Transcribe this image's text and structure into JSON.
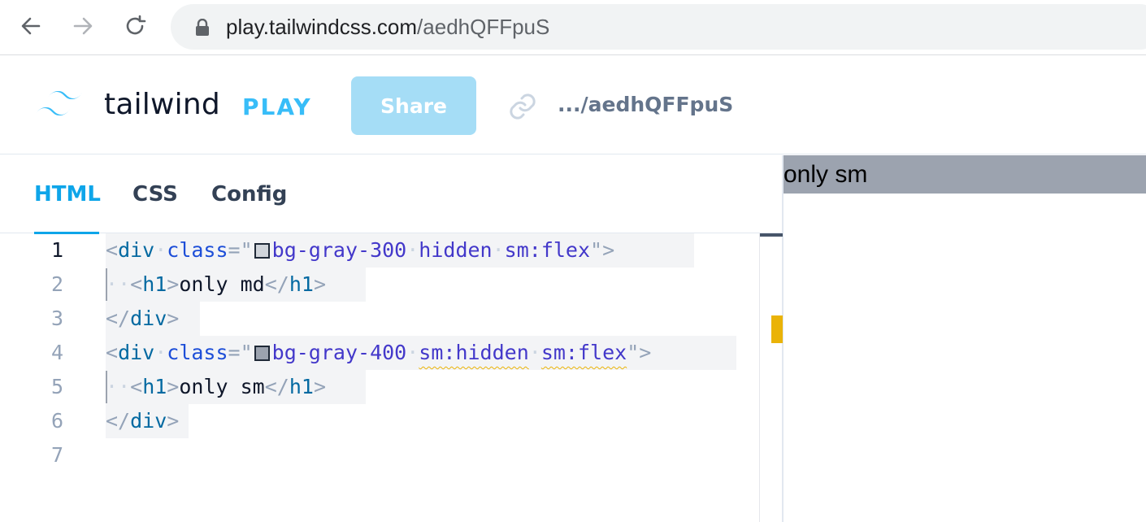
{
  "browser": {
    "url_host": "play.tailwindcss.com",
    "url_path": "/aedhQFFpuS",
    "icons": {
      "back": "arrow-left-icon",
      "forward": "arrow-right-icon",
      "reload": "reload-icon",
      "secure": "lock-icon"
    }
  },
  "header": {
    "brand_name": "tailwind",
    "brand_suffix": "PLAY",
    "share_label": "Share",
    "short_url": ".../aedhQFFpuS",
    "icons": {
      "logo": "tailwind-logo-icon",
      "link": "link-icon"
    }
  },
  "editor": {
    "tabs": [
      {
        "label": "HTML",
        "active": true
      },
      {
        "label": "CSS",
        "active": false
      },
      {
        "label": "Config",
        "active": false
      }
    ],
    "line_numbers": [
      "1",
      "2",
      "3",
      "4",
      "5",
      "6",
      "7"
    ],
    "current_line": 1,
    "lines": [
      "<div class=\"bg-gray-300 hidden sm:flex\">",
      "  <h1>only md</h1>",
      "</div>",
      "<div class=\"bg-gray-400 sm:hidden sm:flex\">",
      "  <h1>only sm</h1>",
      "</div>",
      ""
    ],
    "tokens": {
      "lt": "<",
      "gt": ">",
      "close_lt": "</",
      "div": "div",
      "h1": "h1",
      "class_attr": "class",
      "eq_quote": "=\"",
      "quote": "\"",
      "dot": "·",
      "line1_classes": {
        "bg": "bg-gray-300",
        "c2": "hidden",
        "c3": "sm:flex"
      },
      "line2_text": "only md",
      "line4_classes": {
        "bg": "bg-gray-400",
        "c2": "sm:hidden",
        "c3": "sm:flex"
      },
      "line5_text": "only sm"
    },
    "swatch_colors": {
      "bg-gray-300": "#d1d5db",
      "bg-gray-400": "#9ca3af"
    },
    "warning_color": "#eab308"
  },
  "preview": {
    "text": "only sm",
    "background": "#9ca3af"
  },
  "colors": {
    "accent": "#0ea5e9",
    "share_bg": "#a5ddf6"
  }
}
